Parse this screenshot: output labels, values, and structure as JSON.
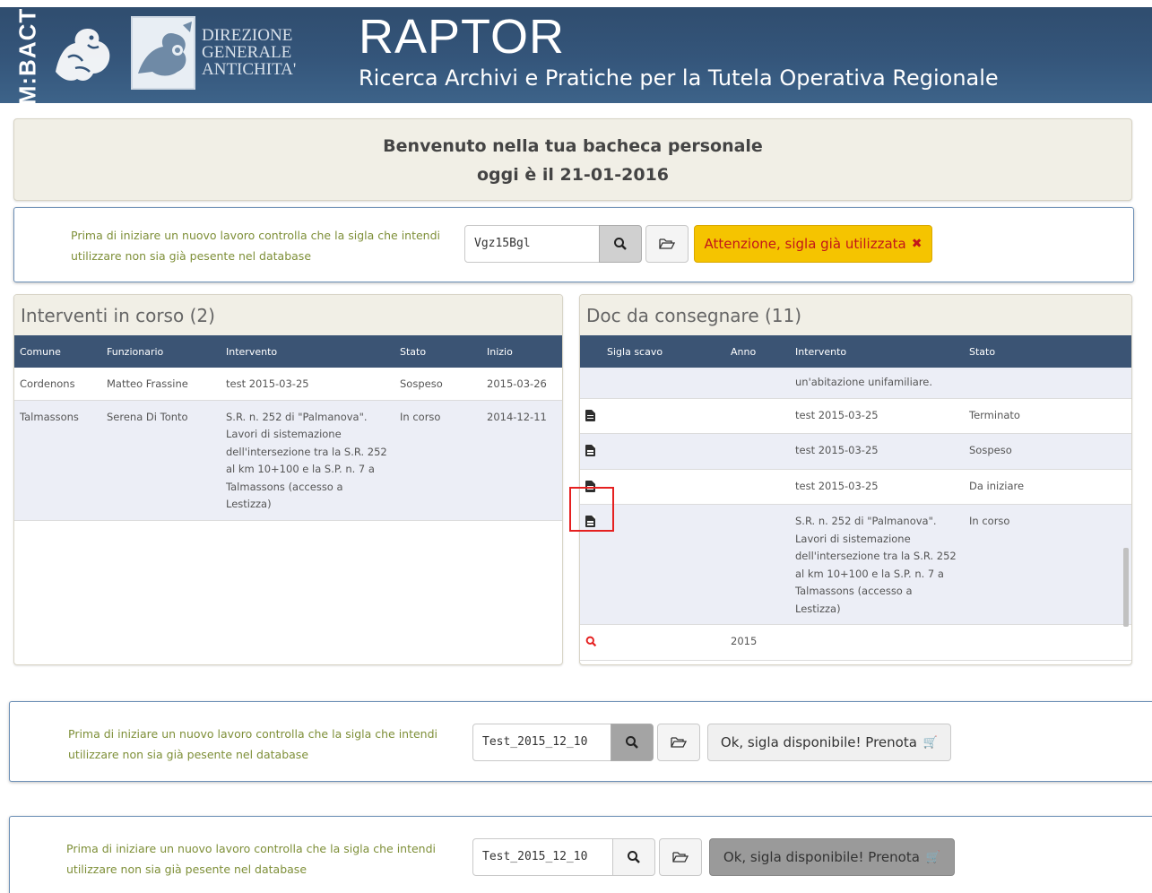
{
  "header": {
    "mibact": "M:BACT",
    "dga_lines": [
      "DIREZIONE",
      "GENERALE",
      "ANTICHITA'"
    ],
    "title": "RAPTOR",
    "subtitle": "Ricerca Archivi e Pratiche per la Tutela Operativa Regionale"
  },
  "welcome": {
    "line1": "Benvenuto nella tua bacheca personale",
    "line2": "oggi è il 21-01-2016"
  },
  "check_hint": {
    "line1": "Prima di iniziare un nuovo lavoro controlla che la sigla che intendi",
    "line2": "utilizzare non sia già pesente nel database"
  },
  "check1": {
    "value": "Vgz15Bgl",
    "status": "Attenzione, sigla già utilizzata",
    "status_color": "#f5c400"
  },
  "check2": {
    "value": "Test_2015_12_10",
    "status": "Ok, sigla disponibile! Prenota"
  },
  "check3": {
    "value": "Test_2015_12_10",
    "status": "Ok, sigla disponibile! Prenota"
  },
  "interventi": {
    "title": "Interventi in corso (2)",
    "columns": [
      "Comune",
      "Funzionario",
      "Intervento",
      "Stato",
      "Inizio"
    ],
    "rows": [
      [
        "Cordenons",
        "Matteo Frassine",
        "test 2015-03-25",
        "Sospeso",
        "2015-03-26"
      ],
      [
        "Talmassons",
        "Serena Di Tonto",
        "S.R. n. 252 di \"Palmanova\". Lavori di sistemazione dell'intersezione tra la S.R. 252 al km 10+100 e la S.P. n. 7 a Talmassons (accesso a Lestizza)",
        "In corso",
        "2014-12-11"
      ]
    ]
  },
  "docs": {
    "title": "Doc da consegnare (11)",
    "columns": [
      "Sigla scavo",
      "Anno",
      "Intervento",
      "Stato"
    ],
    "partial_text": "un'abitazione unifamiliare.",
    "rows": [
      {
        "icon": "file-icon",
        "anno": "",
        "intervento": "test 2015-03-25",
        "stato": "Terminato"
      },
      {
        "icon": "file-icon",
        "anno": "",
        "intervento": "test 2015-03-25",
        "stato": "Sospeso"
      },
      {
        "icon": "file-icon",
        "anno": "",
        "intervento": "test 2015-03-25",
        "stato": "Da iniziare"
      },
      {
        "icon": "file-icon",
        "anno": "",
        "intervento": "S.R. n. 252 di \"Palmanova\". Lavori di sistemazione dell'intersezione tra la S.R. 252 al km 10+100 e la S.P. n. 7 a Talmassons (accesso a Lestizza)",
        "stato": "In corso"
      },
      {
        "icon": "search-icon",
        "anno": "2015",
        "intervento": "",
        "stato": ""
      }
    ]
  },
  "colors": {
    "header_bg": "#34557a",
    "accent_green": "#7e8f38",
    "warning": "#f5c400",
    "highlight_red": "#e52020"
  }
}
